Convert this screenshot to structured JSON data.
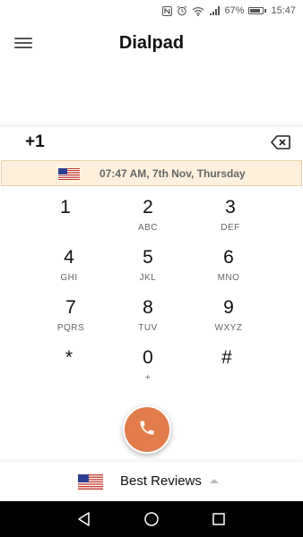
{
  "status_bar": {
    "battery_text": "67%",
    "time": "15:47",
    "battery_level": 0.67,
    "icons": [
      "nfc-icon",
      "alarm-icon",
      "wifi-icon",
      "signal-icon",
      "battery-icon"
    ]
  },
  "header": {
    "title": "Dialpad",
    "menu_icon": "hamburger-menu-icon"
  },
  "dial": {
    "number": "+1",
    "backspace_icon": "backspace-icon"
  },
  "time_banner": {
    "flag": "us-flag-icon",
    "text": "07:47 AM, 7th Nov, Thursday"
  },
  "keypad": [
    {
      "digit": "1",
      "letters": ""
    },
    {
      "digit": "2",
      "letters": "ABC"
    },
    {
      "digit": "3",
      "letters": "DEF"
    },
    {
      "digit": "4",
      "letters": "GHI"
    },
    {
      "digit": "5",
      "letters": "JKL"
    },
    {
      "digit": "6",
      "letters": "MNO"
    },
    {
      "digit": "7",
      "letters": "PQRS"
    },
    {
      "digit": "8",
      "letters": "TUV"
    },
    {
      "digit": "9",
      "letters": "WXYZ"
    },
    {
      "digit": "*",
      "letters": ""
    },
    {
      "digit": "0",
      "letters": "+"
    },
    {
      "digit": "#",
      "letters": ""
    }
  ],
  "call": {
    "icon": "phone-icon",
    "color": "#e27c4a"
  },
  "bottom_bar": {
    "flag": "us-flag-icon",
    "label": "Best Reviews",
    "caret_icon": "caret-up-icon"
  },
  "nav": {
    "back_icon": "nav-back-icon",
    "home_icon": "nav-home-icon",
    "recents_icon": "nav-recents-icon"
  }
}
